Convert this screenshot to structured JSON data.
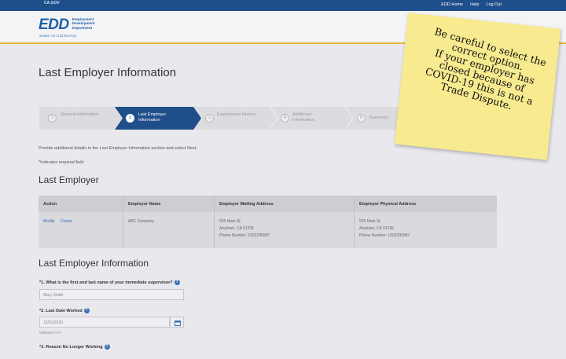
{
  "topbar": {
    "links": [
      "EDD Home",
      "Help",
      "Log Out"
    ]
  },
  "logo": {
    "text": "EDD",
    "dept": [
      "Employment",
      "Development",
      "Department"
    ],
    "state": "State of California"
  },
  "page_title": "Last Employer Information",
  "stepper": [
    {
      "num": "1",
      "label": "General Information",
      "active": false
    },
    {
      "num": "2",
      "label": "Last Employer Information",
      "active": true
    },
    {
      "num": "3",
      "label": "Employment History",
      "active": false
    },
    {
      "num": "4",
      "label": "Additional Information",
      "active": false
    },
    {
      "num": "5",
      "label": "Summary",
      "active": false
    }
  ],
  "sticky_note": {
    "lines": [
      "Be careful to select the",
      "correct option.",
      "If your employer has",
      "closed because of",
      "COVID-19 this is not a",
      "Trade Dispute."
    ]
  },
  "help_text": "Provide additional details in the Last Employer Information section and select Next.",
  "required_text": "*Indicates required field",
  "section1_title": "Last Employer",
  "table": {
    "headers": [
      "Action",
      "Employer Name",
      "Employer Mailing Address",
      "Employer Physical Address"
    ],
    "row": {
      "actions": [
        "Modify",
        "Delete"
      ],
      "employer_name": "ABC Company",
      "mailing_address": [
        "555 Main St.",
        "Anytown, CA 91235",
        "Phone Number: 1502295987"
      ],
      "physical_address": [
        "555 Main St.",
        "Anytown, CA 91235",
        "Phone Number: 1502295987"
      ]
    }
  },
  "section2_title": "Last Employer Information",
  "questions": {
    "q1": {
      "label": "*1. What is the first and last name of your immediate supervisor?",
      "value": "Mary Smith"
    },
    "q2": {
      "label": "*2. Last Date Worked",
      "value": "12/01/2020",
      "hint": "MM/DD/YYYY"
    },
    "q3": {
      "label": "*3. Reason No Longer Working"
    }
  },
  "colors": {
    "topbar": "#1f4f8a",
    "active_step": "#1f4f8a",
    "accent_line": "#e8b23a",
    "sticky": "#f7ea8f",
    "link": "#3a6fb5"
  }
}
